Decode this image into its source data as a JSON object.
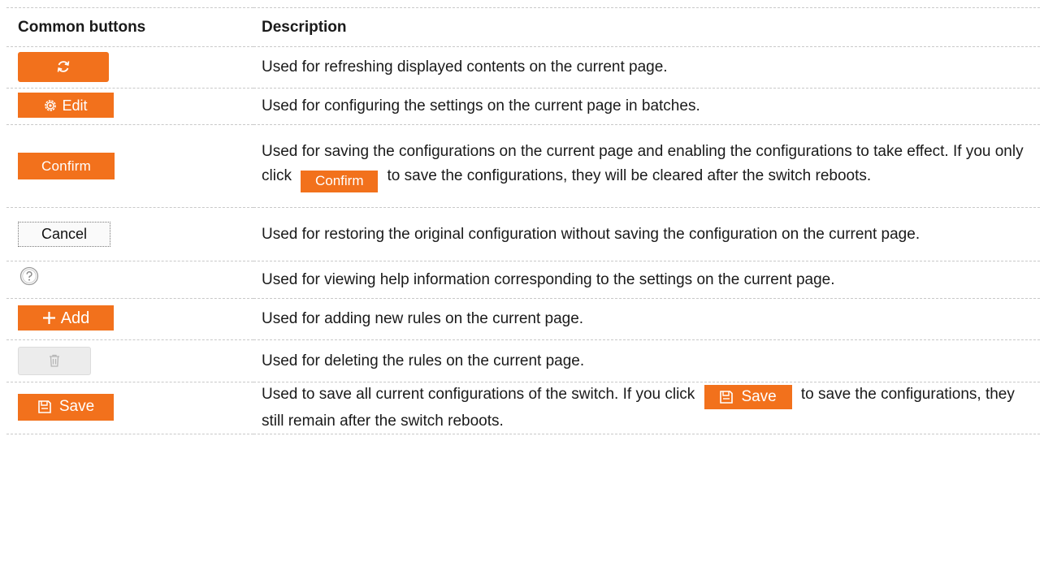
{
  "table": {
    "headers": [
      "Common buttons",
      "Description"
    ],
    "rows": [
      {
        "button_icon": "refresh-icon",
        "description": "Used for refreshing displayed contents on the current page."
      },
      {
        "button_icon": "gear-icon",
        "button_label": "Edit",
        "description": "Used for configuring the settings on the current page in batches."
      },
      {
        "button_label": "Confirm",
        "description_before": "Used for saving the configurations on the current page and enabling the configurations to take effect. If you only click",
        "inline_button_label": "Confirm",
        "description_after": "to save the configurations, they will be cleared after the switch reboots."
      },
      {
        "button_label": "Cancel",
        "description": "Used for restoring the original configuration without saving the configuration on the current page."
      },
      {
        "button_icon": "help-icon",
        "description": "Used for viewing help information corresponding to the settings on the current page."
      },
      {
        "button_icon": "plus-icon",
        "button_label": "Add",
        "description": "Used for adding new rules on the current page."
      },
      {
        "button_icon": "trash-icon",
        "description": "Used for deleting the rules on the current page."
      },
      {
        "button_icon": "floppy-disk-icon",
        "button_label": "Save",
        "description_before": "Used to save all current configurations of the switch. If you click",
        "inline_button_label": "Save",
        "description_after": "to save the configurations, they still remain after the switch reboots."
      }
    ]
  },
  "colors": {
    "button_orange": "#f2711c",
    "delete_button_gray": "#ececec",
    "divider": "#c9c9c9"
  }
}
